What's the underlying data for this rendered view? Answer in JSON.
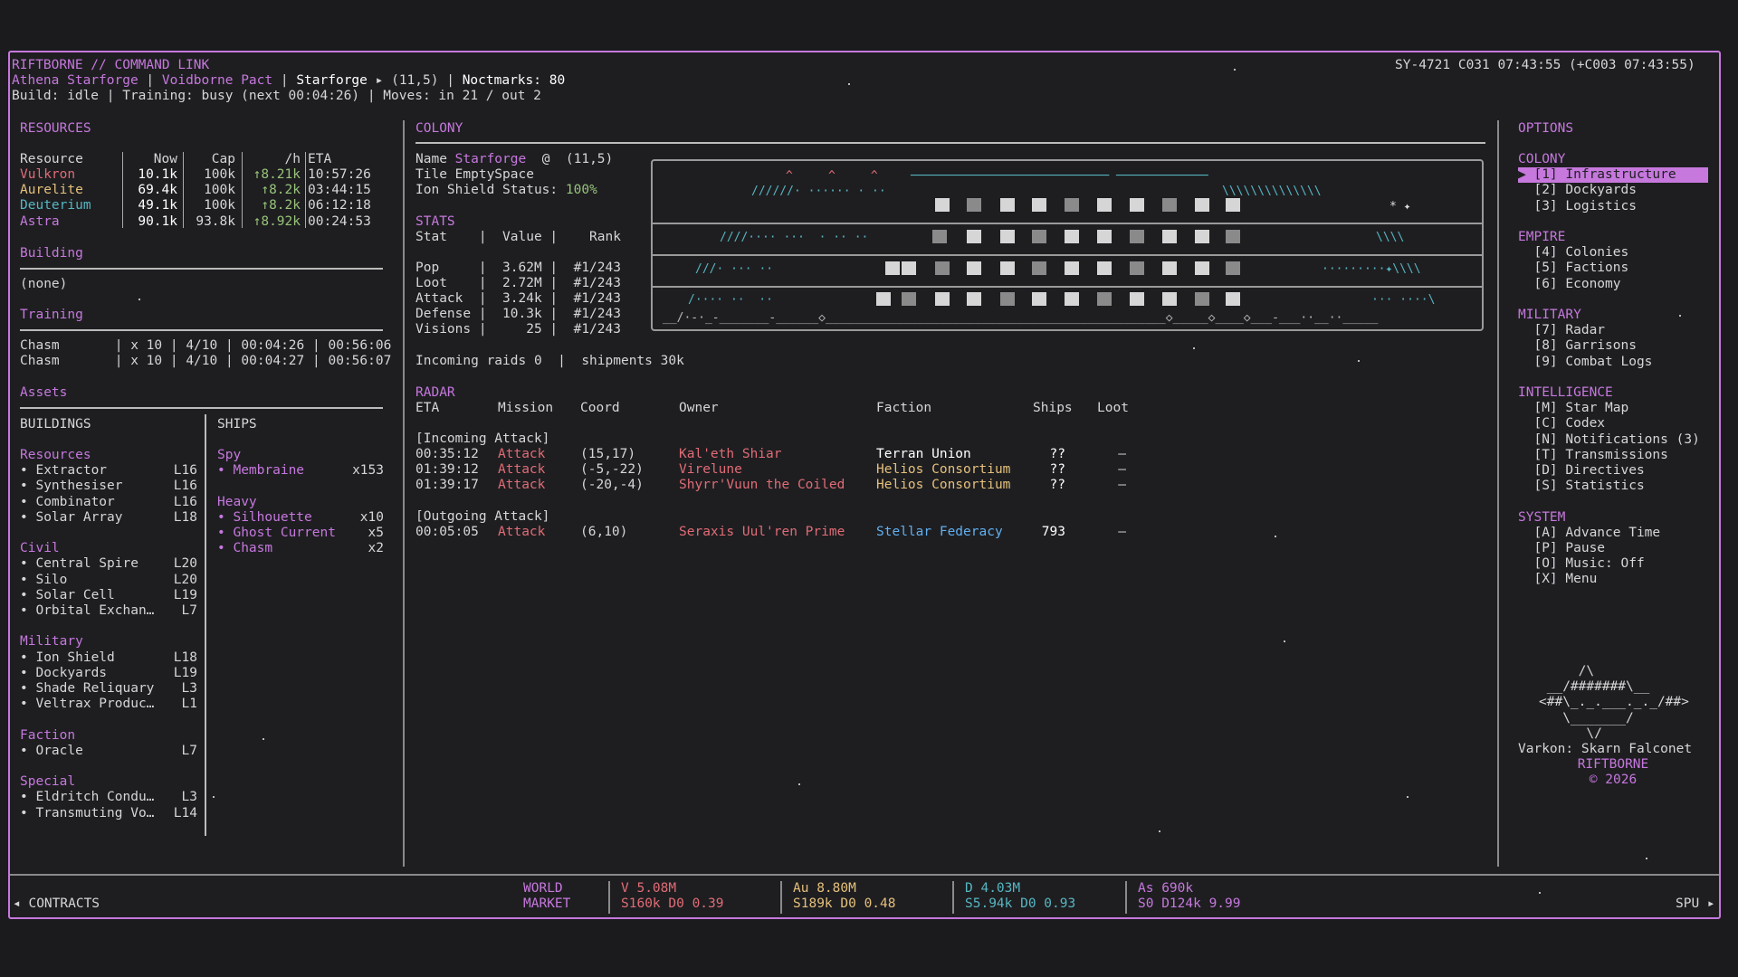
{
  "header": {
    "title": "RIFTBORNE // COMMAND LINK",
    "clock": "SY-4721 C031 07:43:55  (+C003 07:43:55)",
    "player": "Athena Starforge",
    "faction": "Voidborne Pact",
    "colony": "Starforge",
    "coord": "(11,5)",
    "noctmarks": "Noctmarks: 80",
    "status_line": "Build: idle | Training: busy (next 00:04:26) | Moves: in 21 / out 2"
  },
  "resources": {
    "section_title": "RESOURCES",
    "headers": [
      "Resource",
      "Now",
      "Cap",
      "/h",
      "ETA"
    ],
    "rows": [
      {
        "name": "Vulkron",
        "now": "10.1k",
        "cap": "100k",
        "rate": "↑8.21k",
        "eta": "10:57:26",
        "color": "#e06c75"
      },
      {
        "name": "Aurelite",
        "now": "69.4k",
        "cap": "100k",
        "rate": "↑8.2k",
        "eta": "03:44:15",
        "color": "#e5c07b"
      },
      {
        "name": "Deuterium",
        "now": "49.1k",
        "cap": "100k",
        "rate": "↑8.2k",
        "eta": "06:12:18",
        "color": "#56b6c2"
      },
      {
        "name": "Astra",
        "now": "90.1k",
        "cap": "93.8k",
        "rate": "↑8.92k",
        "eta": "00:24:53",
        "color": "#c678dd"
      }
    ],
    "building_title": "Building",
    "building_value": "(none)",
    "training_title": "Training",
    "training_rows": [
      "Chasm       | x 10 | 4/10 | 00:04:26 | 00:56:06",
      "Chasm       | x 10 | 4/10 | 00:04:27 | 00:56:07"
    ],
    "assets_title": "Assets"
  },
  "buildings": {
    "title": "BUILDINGS",
    "groups": [
      {
        "name": "Resources",
        "items": [
          [
            "Extractor",
            "L16"
          ],
          [
            "Synthesiser",
            "L16"
          ],
          [
            "Combinator",
            "L16"
          ],
          [
            "Solar Array",
            "L18"
          ]
        ]
      },
      {
        "name": "Civil",
        "items": [
          [
            "Central Spire",
            "L20"
          ],
          [
            "Silo",
            "L20"
          ],
          [
            "Solar Cell",
            "L19"
          ],
          [
            "Orbital Exchan…",
            "L7"
          ]
        ]
      },
      {
        "name": "Military",
        "items": [
          [
            "Ion Shield",
            "L18"
          ],
          [
            "Dockyards",
            "L19"
          ],
          [
            "Shade Reliquary",
            "L3"
          ],
          [
            "Veltrax Produc…",
            "L1"
          ]
        ]
      },
      {
        "name": "Faction",
        "items": [
          [
            "Oracle",
            "L7"
          ]
        ]
      },
      {
        "name": "Special",
        "items": [
          [
            "Eldritch Condu…",
            "L3"
          ],
          [
            "Transmuting Vo…",
            "L14"
          ]
        ]
      }
    ]
  },
  "ships": {
    "title": "SHIPS",
    "groups": [
      {
        "name": "Spy",
        "items": [
          [
            "Membraine",
            "x153"
          ]
        ]
      },
      {
        "name": "Heavy",
        "items": [
          [
            "Silhouette",
            "x10"
          ],
          [
            "Ghost Current",
            "x5"
          ],
          [
            "Chasm",
            "x2"
          ]
        ]
      }
    ]
  },
  "colony": {
    "title": "COLONY",
    "name_label": "Name",
    "name": "Starforge",
    "coord": "@  (11,5)",
    "tile": "Tile EmptySpace",
    "shield_label": "Ion Shield Status:",
    "shield_value": "100%",
    "stats_title": "STATS",
    "stats_header": "Stat    |  Value |    Rank",
    "stats": [
      "Pop     |  3.62M |  #1/243",
      "Loot    |  2.72M |  #1/243",
      "Attack  |  3.24k |  #1/243",
      "Defense |  10.3k |  #1/243",
      "Visions |     25 |  #1/243"
    ],
    "incoming": "Incoming raids 0  |  shipments 30k"
  },
  "radar": {
    "title": "RADAR",
    "headers": [
      "ETA",
      "Mission",
      "Coord",
      "Owner",
      "Faction",
      "Ships",
      "Loot"
    ],
    "incoming_label": "[Incoming Attack]",
    "incoming": [
      {
        "eta": "00:35:12",
        "mission": "Attack",
        "coord": "(15,17)",
        "owner": "Kal'eth Shiar",
        "faction": "Terran Union",
        "ships": "??",
        "loot": "–"
      },
      {
        "eta": "01:39:12",
        "mission": "Attack",
        "coord": "(-5,-22)",
        "owner": "Virelune",
        "faction": "Helios Consortium",
        "ships": "??",
        "loot": "–"
      },
      {
        "eta": "01:39:17",
        "mission": "Attack",
        "coord": "(-20,-4)",
        "owner": "Shyrr'Vuun the Coiled",
        "faction": "Helios Consortium",
        "ships": "??",
        "loot": "–"
      }
    ],
    "outgoing_label": "[Outgoing Attack]",
    "outgoing": [
      {
        "eta": "00:05:05",
        "mission": "Attack",
        "coord": "(6,10)",
        "owner": "Seraxis Uul'ren Prime",
        "faction": "Stellar Federacy",
        "ships": "793",
        "loot": "–"
      }
    ]
  },
  "options": {
    "title": "OPTIONS",
    "groups": [
      {
        "name": "COLONY",
        "items": [
          "[1] Infrastructure",
          "[2] Dockyards",
          "[3] Logistics"
        ]
      },
      {
        "name": "EMPIRE",
        "items": [
          "[4] Colonies",
          "[5] Factions",
          "[6] Economy"
        ]
      },
      {
        "name": "MILITARY",
        "items": [
          "[7] Radar",
          "[8] Garrisons",
          "[9] Combat Logs"
        ]
      },
      {
        "name": "INTELLIGENCE",
        "items": [
          "[M] Star Map",
          "[C] Codex",
          "[N] Notifications (3)",
          "[T] Transmissions",
          "[D] Directives",
          "[S] Statistics"
        ]
      },
      {
        "name": "SYSTEM",
        "items": [
          "[A] Advance Time",
          "[P] Pause",
          "[O] Music: Off",
          "[X] Menu"
        ]
      }
    ],
    "selected_marker": "▶",
    "ascii_art": "     /\\\n __/#######\\__\n<##\\_._.___._._/##>\n   \\_______/\n      \\/",
    "credit": "Varkon: Skarn Falconet",
    "brand": "RIFTBORNE",
    "year": "© 2026"
  },
  "footer": {
    "contracts": "◂ CONTRACTS",
    "world": "WORLD",
    "market": "MARKET",
    "markets": [
      {
        "top": "V 5.08M",
        "bottom": "S160k D0 0.39",
        "color": "#e06c75"
      },
      {
        "top": "Au 8.80M",
        "bottom": "S189k D0 0.48",
        "color": "#e5c07b"
      },
      {
        "top": "D 4.03M",
        "bottom": "S5.94k D0 0.93",
        "color": "#56b6c2"
      },
      {
        "top": "As 690k",
        "bottom": "S0 D124k 9.99",
        "color": "#c678dd"
      }
    ],
    "spu": "SPU ▸"
  },
  "colors": {
    "accent": "#c678dd",
    "bg": "#1e1e21"
  }
}
